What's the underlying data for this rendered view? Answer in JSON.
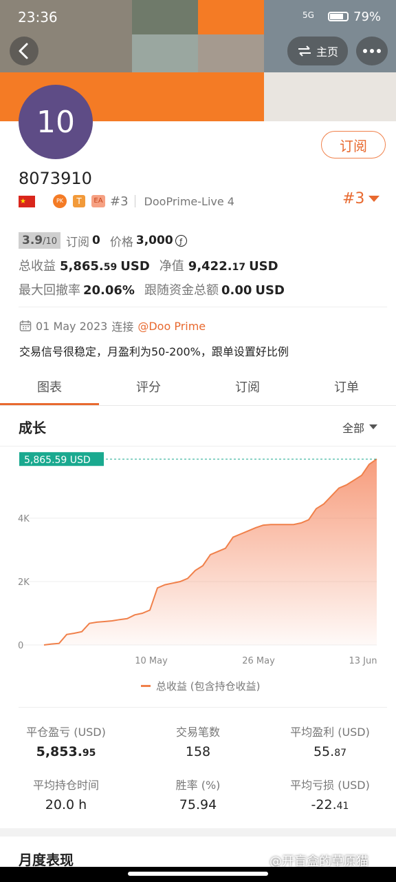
{
  "status_bar": {
    "time": "23:36",
    "network": "5G",
    "battery": "79%"
  },
  "header": {
    "home_label": "主页"
  },
  "profile": {
    "avatar_text": "10",
    "account_id": "8073910",
    "rank": "#3",
    "server": "DooPrime-Live 4",
    "rank_dropdown": "#3",
    "subscribe_label": "订阅",
    "badges": [
      "PK",
      "T",
      "EA"
    ]
  },
  "metrics": {
    "score": "3.9",
    "score_max": "/10",
    "subscriptions_label": "订阅",
    "subscriptions_value": "0",
    "price_label": "价格",
    "price_value": "3,000",
    "total_profit_label": "总收益",
    "total_profit_int": "5,865.",
    "total_profit_dec": "59",
    "total_profit_unit": "USD",
    "net_value_label": "净值",
    "net_value_int": "9,422.",
    "net_value_dec": "17",
    "net_value_unit": "USD",
    "max_drawdown_label": "最大回撤率",
    "max_drawdown_value": "20.06%",
    "follow_funds_label": "跟随资金总额",
    "follow_funds_value": "0.00",
    "follow_funds_unit": "USD"
  },
  "connection": {
    "date": "01 May 2023",
    "connect_label": "连接",
    "broker": "@Doo Prime"
  },
  "description": "交易信号很稳定，月盈利为50-200%，跟单设置好比例",
  "tabs": [
    "图表",
    "评分",
    "订阅",
    "订单"
  ],
  "growth": {
    "title": "成长",
    "filter": "全部"
  },
  "chart_data": {
    "type": "area",
    "title": "",
    "x_ticks": [
      "10 May",
      "26 May",
      "13 Jun"
    ],
    "y_ticks": [
      "0",
      "2K",
      "4K"
    ],
    "ylim": [
      0,
      6000
    ],
    "current_label": "5,865.59 USD",
    "legend": "总收益 (包含持仓收益)",
    "series": [
      {
        "name": "总收益 (包含持仓收益)",
        "x": [
          0,
          1,
          2,
          3,
          4,
          5,
          6,
          7,
          8,
          9,
          10,
          11,
          12,
          13,
          14,
          15,
          16,
          17,
          18,
          19,
          20,
          21,
          22,
          23,
          24,
          25,
          26,
          27,
          28,
          29,
          30,
          31,
          32,
          33,
          34,
          35,
          36,
          37,
          38,
          39,
          40,
          41,
          42,
          43,
          44
        ],
        "values": [
          0,
          30,
          50,
          330,
          370,
          420,
          680,
          720,
          740,
          760,
          800,
          830,
          950,
          1000,
          1100,
          1800,
          1900,
          1950,
          2000,
          2100,
          2350,
          2500,
          2850,
          2950,
          3050,
          3400,
          3500,
          3600,
          3700,
          3780,
          3800,
          3800,
          3800,
          3800,
          3850,
          3950,
          4300,
          4450,
          4700,
          4950,
          5050,
          5200,
          5350,
          5700,
          5865
        ]
      }
    ]
  },
  "stats": {
    "close_pnl_label": "平仓盈亏 (USD)",
    "close_pnl_int": "5,853.",
    "close_pnl_dec": "95",
    "trades_label": "交易笔数",
    "trades_value": "158",
    "avg_profit_label": "平均盈利 (USD)",
    "avg_profit_int": "55.",
    "avg_profit_dec": "87",
    "avg_hold_label": "平均持仓时间",
    "avg_hold_value": "20.0 h",
    "win_rate_label": "胜率 (%)",
    "win_rate_value": "75.94",
    "avg_loss_label": "平均亏损 (USD)",
    "avg_loss_int": "-22.",
    "avg_loss_dec": "41"
  },
  "monthly": {
    "title": "月度表现"
  },
  "watermark": "@开盲盒的草原猫",
  "colors": {
    "accent": "#e8692f",
    "banner": "#f47b25",
    "green": "#1aa98f",
    "avatar": "#5e4c86"
  }
}
